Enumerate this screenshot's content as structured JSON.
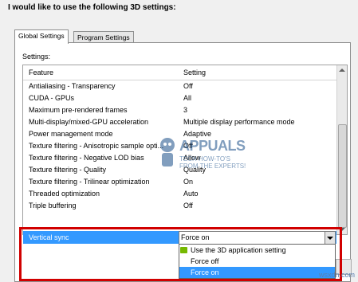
{
  "heading": "I would like to use the following 3D settings:",
  "tabs": [
    {
      "label": "Global Settings",
      "active": true
    },
    {
      "label": "Program Settings",
      "active": false
    }
  ],
  "settings_label": "Settings:",
  "table": {
    "headers": {
      "feature": "Feature",
      "setting": "Setting"
    },
    "rows": [
      {
        "feature": "Antialiasing - Transparency",
        "setting": "Off"
      },
      {
        "feature": "CUDA - GPUs",
        "setting": "All"
      },
      {
        "feature": "Maximum pre-rendered frames",
        "setting": "3"
      },
      {
        "feature": "Multi-display/mixed-GPU acceleration",
        "setting": "Multiple display performance mode"
      },
      {
        "feature": "Power management mode",
        "setting": "Adaptive"
      },
      {
        "feature": "Texture filtering - Anisotropic sample opti...",
        "setting": "Off"
      },
      {
        "feature": "Texture filtering - Negative LOD bias",
        "setting": "Allow"
      },
      {
        "feature": "Texture filtering - Quality",
        "setting": "Quality"
      },
      {
        "feature": "Texture filtering - Trilinear optimization",
        "setting": "On"
      },
      {
        "feature": "Threaded optimization",
        "setting": "Auto"
      },
      {
        "feature": "Triple buffering",
        "setting": "Off"
      }
    ],
    "selected_row": {
      "feature": "Vertical sync",
      "setting": "Force on"
    }
  },
  "dropdown_options": [
    {
      "label": "Use the 3D application setting",
      "icon": "nvidia-logo-icon",
      "selected": false
    },
    {
      "label": "Force off",
      "selected": false
    },
    {
      "label": "Force on",
      "selected": true
    }
  ],
  "watermark": {
    "name": "APPUALS",
    "tagline": "TECH HOW-TO'S FROM THE EXPERTS!"
  },
  "footer_mark": "wsxdn.com",
  "colors": {
    "selection": "#3399ff",
    "highlight_frame": "#d10000",
    "nvidia_green": "#76b900"
  }
}
